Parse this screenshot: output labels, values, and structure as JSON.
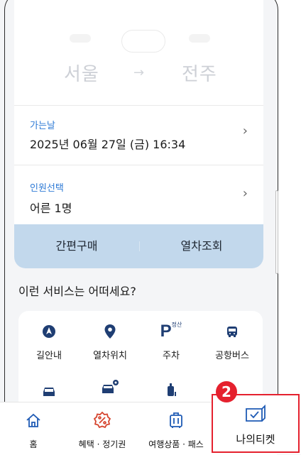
{
  "route": {
    "from": "서울",
    "arrow": "→",
    "to": "전주"
  },
  "departure": {
    "label": "가는날",
    "value": "2025년 06월 27일 (금) 16:34",
    "chevron": "›"
  },
  "passengers": {
    "label": "인원선택",
    "value": "어른 1명",
    "chevron": "›"
  },
  "actions": {
    "quick_buy": "간편구매",
    "train_search": "열차조회"
  },
  "services": {
    "title": "이런 서비스는 어떠세요?",
    "items": [
      {
        "label": "길안내",
        "icon": "navigation-icon"
      },
      {
        "label": "열차위치",
        "icon": "location-pin-icon"
      },
      {
        "label": "주차",
        "icon": "parking-icon",
        "superscript": "정산"
      },
      {
        "label": "공항버스",
        "icon": "bus-icon"
      }
    ],
    "row2_icons": [
      "car-icon",
      "car-settings-icon",
      "luggage-icon"
    ]
  },
  "nav": {
    "items": [
      {
        "label": "홈",
        "icon": "home-icon"
      },
      {
        "label": "혜택 · 정기권",
        "icon": "discount-badge-icon"
      },
      {
        "label": "여행상품 · 패스",
        "icon": "suitcase-icon"
      },
      {
        "label": "나의티켓",
        "icon": "ticket-check-icon"
      }
    ]
  },
  "annotation": {
    "badge": "2"
  },
  "colors": {
    "accent": "#2f7bd6",
    "action_bar": "#c2d8ec",
    "highlight": "#e5212e",
    "icon_navy": "#1f3e73"
  }
}
